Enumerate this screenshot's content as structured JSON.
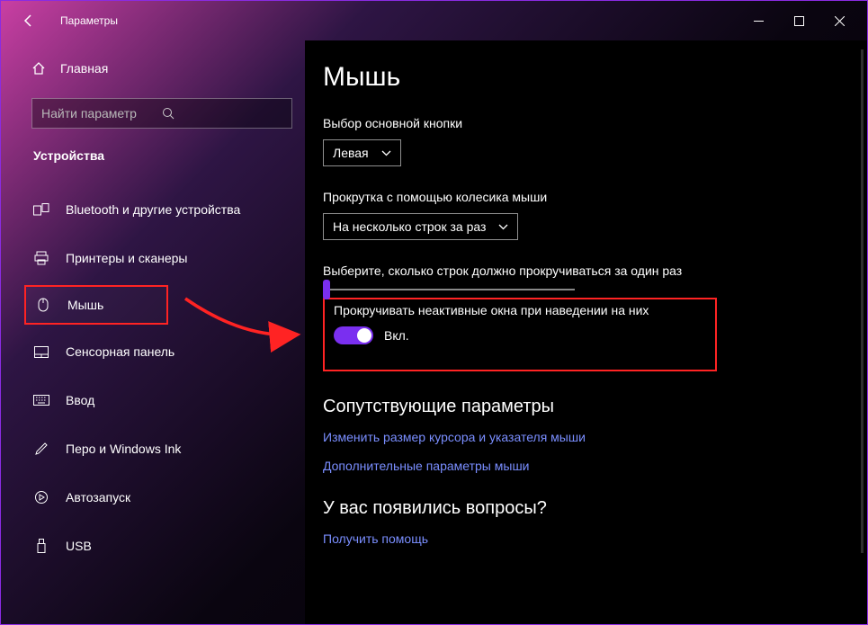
{
  "titlebar": {
    "title": "Параметры"
  },
  "sidebar": {
    "home": "Главная",
    "search_placeholder": "Найти параметр",
    "section": "Устройства",
    "items": [
      {
        "label": "Bluetooth и другие устройства"
      },
      {
        "label": "Принтеры и сканеры"
      },
      {
        "label": "Мышь"
      },
      {
        "label": "Сенсорная панель"
      },
      {
        "label": "Ввод"
      },
      {
        "label": "Перо и Windows Ink"
      },
      {
        "label": "Автозапуск"
      },
      {
        "label": "USB"
      }
    ]
  },
  "main": {
    "heading": "Мышь",
    "primary_button_label": "Выбор основной кнопки",
    "primary_button_value": "Левая",
    "scroll_mode_label": "Прокрутка с помощью колесика мыши",
    "scroll_mode_value": "На несколько строк за раз",
    "lines_label": "Выберите, сколько строк должно прокручиваться за один раз",
    "inactive_scroll_label": "Прокручивать неактивные окна при наведении на них",
    "toggle_state": "Вкл.",
    "related_heading": "Сопутствующие параметры",
    "link_cursor": "Изменить размер курсора и указателя мыши",
    "link_additional": "Дополнительные параметры мыши",
    "help_heading": "У вас появились вопросы?",
    "link_help": "Получить помощь"
  }
}
